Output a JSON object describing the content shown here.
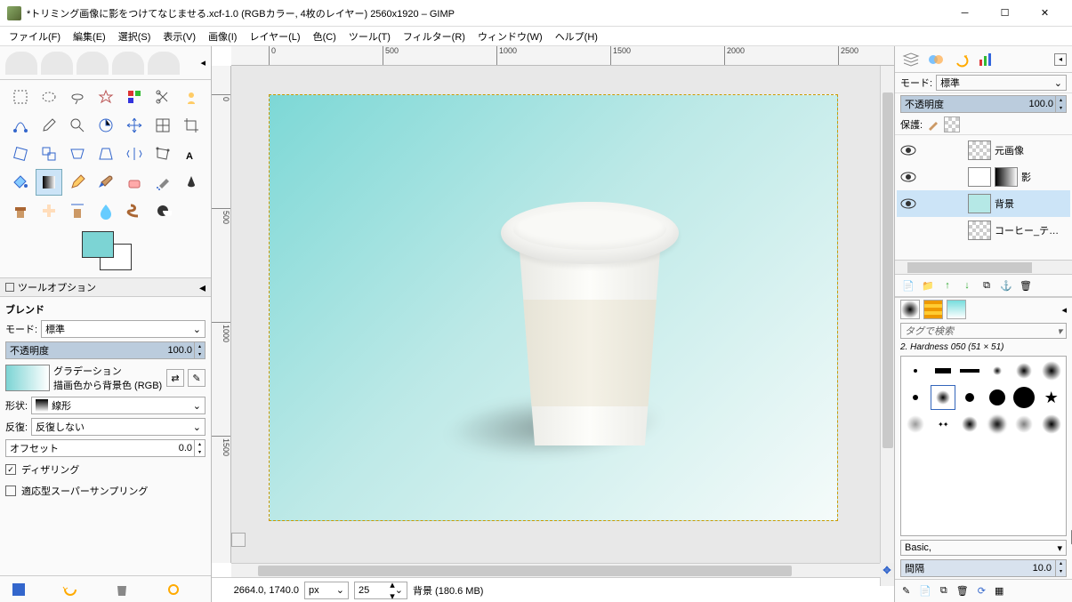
{
  "title": "*トリミング画像に影をつけてなじませる.xcf-1.0 (RGBカラー, 4枚のレイヤー) 2560x1920 – GIMP",
  "menu": {
    "file": "ファイル(F)",
    "edit": "編集(E)",
    "select": "選択(S)",
    "view": "表示(V)",
    "image": "画像(I)",
    "layer": "レイヤー(L)",
    "color": "色(C)",
    "tool": "ツール(T)",
    "filter": "フィルター(R)",
    "window": "ウィンドウ(W)",
    "help": "ヘルプ(H)"
  },
  "ruler": {
    "h": [
      "0",
      "500",
      "1000",
      "1500",
      "2000",
      "2500"
    ],
    "v": [
      "0",
      "500",
      "1000",
      "1500"
    ]
  },
  "toolopts": {
    "panel_title": "ツールオプション",
    "section": "ブレンド",
    "mode_label": "モード:",
    "mode_value": "標準",
    "opacity_label": "不透明度",
    "opacity_value": "100.0",
    "gradient_label": "グラデーション",
    "gradient_sub": "描画色から背景色 (RGB)",
    "shape_label": "形状:",
    "shape_value": "線形",
    "repeat_label": "反復:",
    "repeat_value": "反復しない",
    "offset_label": "オフセット",
    "offset_value": "0.0",
    "dither": "ディザリング",
    "supersample": "適応型スーパーサンプリング"
  },
  "status": {
    "coord": "2664.0, 1740.0",
    "unit": "px",
    "zoom": "25",
    "layer": "背景 (180.6 MB)"
  },
  "layers_panel": {
    "mode_label": "モード:",
    "mode_value": "標準",
    "opacity_label": "不透明度",
    "opacity_value": "100.0",
    "protect_label": "保護:",
    "layers": [
      {
        "name": "元画像"
      },
      {
        "name": "影"
      },
      {
        "name": "背景",
        "sel": true,
        "bg": "#b5e8e6"
      },
      {
        "name": "コーヒー_テイクアウト"
      }
    ]
  },
  "brush": {
    "tag_placeholder": "タグで検索",
    "info": "2. Hardness 050 (51 × 51)",
    "preset": "Basic,",
    "spacing_label": "間隔",
    "spacing_value": "10.0"
  }
}
